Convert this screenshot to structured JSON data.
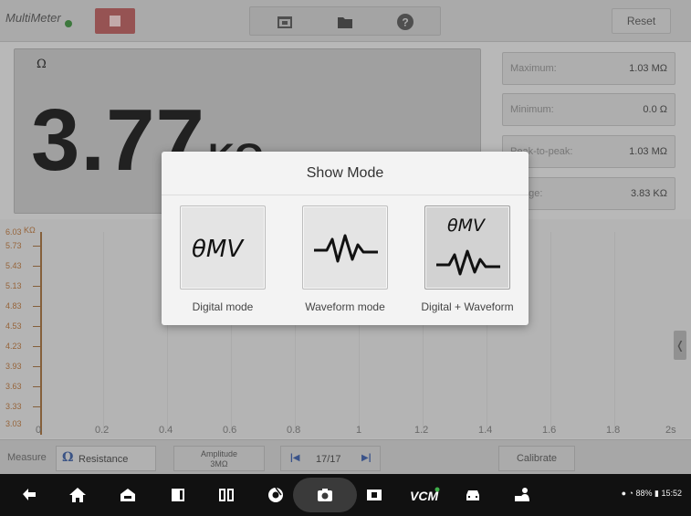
{
  "app": {
    "title": "MultiMeter",
    "reset_label": "Reset"
  },
  "display": {
    "unit_symbol": "Ω",
    "reading": "3.77",
    "reading_unit": "KΩ"
  },
  "stats": [
    {
      "label": "Maximum:",
      "value": "1.03 MΩ"
    },
    {
      "label": "Minimum:",
      "value": "0.0 Ω"
    },
    {
      "label": "Peak-to-peak:",
      "value": "1.03 MΩ"
    },
    {
      "label": "Range:",
      "value": "3.83 KΩ"
    }
  ],
  "graph": {
    "y_ticks": [
      "6.03",
      "5.73",
      "5.43",
      "5.13",
      "4.83",
      "4.53",
      "4.23",
      "3.93",
      "3.63",
      "3.33",
      "3.03"
    ],
    "y_unit": "KΩ",
    "x_ticks": [
      "0",
      "0.2",
      "0.4",
      "0.6",
      "0.8",
      "1",
      "1.2",
      "1.4",
      "1.6",
      "1.8",
      "2s"
    ]
  },
  "bottom": {
    "measure_label": "Measure",
    "measure_value": "Resistance",
    "amplitude_label": "Amplitude",
    "amplitude_value": "3MΩ",
    "page_count": "17/17",
    "calibrate_label": "Calibrate"
  },
  "dialog": {
    "title": "Show Mode",
    "icon_text": "θMV",
    "modes": [
      {
        "label": "Digital mode",
        "icon": "digital-display-icon",
        "selected": false
      },
      {
        "label": "Waveform mode",
        "icon": "waveform-icon",
        "selected": false
      },
      {
        "label": "Digital + Waveform",
        "icon": "digital-waveform-icon",
        "selected": true
      }
    ]
  },
  "statusbar": {
    "battery": "88%",
    "time": "15:52"
  },
  "colors": {
    "accent_tick": "#b0703a",
    "stop_button": "#b05a5a",
    "navbar": "#111111"
  }
}
